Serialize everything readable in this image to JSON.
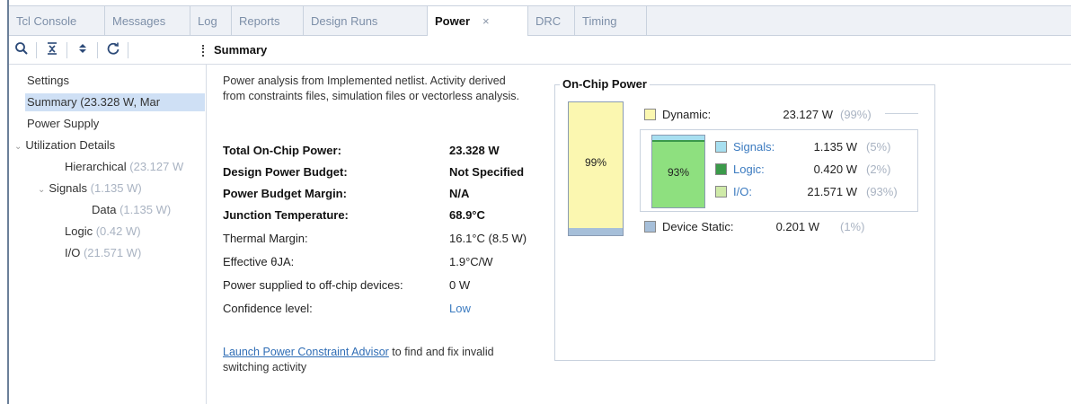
{
  "tabs": [
    {
      "label": "Tcl Console"
    },
    {
      "label": "Messages"
    },
    {
      "label": "Log"
    },
    {
      "label": "Reports"
    },
    {
      "label": "Design Runs"
    },
    {
      "label": "Power",
      "close": "×"
    },
    {
      "label": "DRC"
    },
    {
      "label": "Timing"
    }
  ],
  "toolbar": {
    "icons": [
      "search-icon",
      "collapse-all-icon",
      "expand-all-icon",
      "refresh-icon"
    ],
    "title": "Summary"
  },
  "tree": {
    "items": [
      {
        "label": "Settings"
      },
      {
        "label": "Summary (23.328 W, Mar"
      },
      {
        "label": "Power Supply"
      },
      {
        "label": "Utilization Details",
        "caret": "⌄"
      },
      {
        "label": "Hierarchical",
        "paren": "(23.127 W"
      },
      {
        "label": "Signals",
        "paren": "(1.135 W)",
        "caret": "⌄"
      },
      {
        "label": "Data",
        "paren": "(1.135 W)"
      },
      {
        "label": "Logic",
        "paren": "(0.42 W)"
      },
      {
        "label": "I/O",
        "paren": "(21.571 W)"
      }
    ]
  },
  "summary": {
    "intro": "Power analysis from Implemented netlist. Activity derived from constraints files, simulation files or vectorless analysis.",
    "rows": [
      {
        "label": "Total On-Chip Power:",
        "value": "23.328 W"
      },
      {
        "label": "Design Power Budget:",
        "value": "Not Specified"
      },
      {
        "label": "Power Budget Margin:",
        "value": "N/A"
      },
      {
        "label": "Junction Temperature:",
        "value": "68.9°C"
      },
      {
        "label": "Thermal Margin:",
        "value": "16.1°C (8.5 W)"
      },
      {
        "label": "Effective θJA:",
        "value": "1.9°C/W"
      },
      {
        "label": "Power supplied to off-chip devices:",
        "value": "0 W"
      },
      {
        "label": "Confidence level:",
        "value": "Low"
      }
    ],
    "advisor_link": "Launch Power Constraint Advisor",
    "advisor_text": " to find and fix invalid switching activity"
  },
  "on_chip_power": {
    "title": "On-Chip Power",
    "main_bar_pct": "99%",
    "sub_bar_pct": "93%",
    "dynamic": {
      "label": "Dynamic:",
      "watts": "23.127 W",
      "pct": "(99%)",
      "color": "#fbf7b0"
    },
    "signals": {
      "label": "Signals:",
      "watts": "1.135 W",
      "pct": "(5%)",
      "color": "#a7dff0"
    },
    "logic": {
      "label": "Logic:",
      "watts": "0.420 W",
      "pct": "(2%)",
      "color": "#3b9a4a"
    },
    "io": {
      "label": "I/O:",
      "watts": "21.571 W",
      "pct": "(93%)",
      "color": "#8ee07f"
    },
    "static": {
      "label": "Device Static:",
      "watts": "0.201 W",
      "pct": "(1%)",
      "color": "#a6bfd9"
    }
  }
}
